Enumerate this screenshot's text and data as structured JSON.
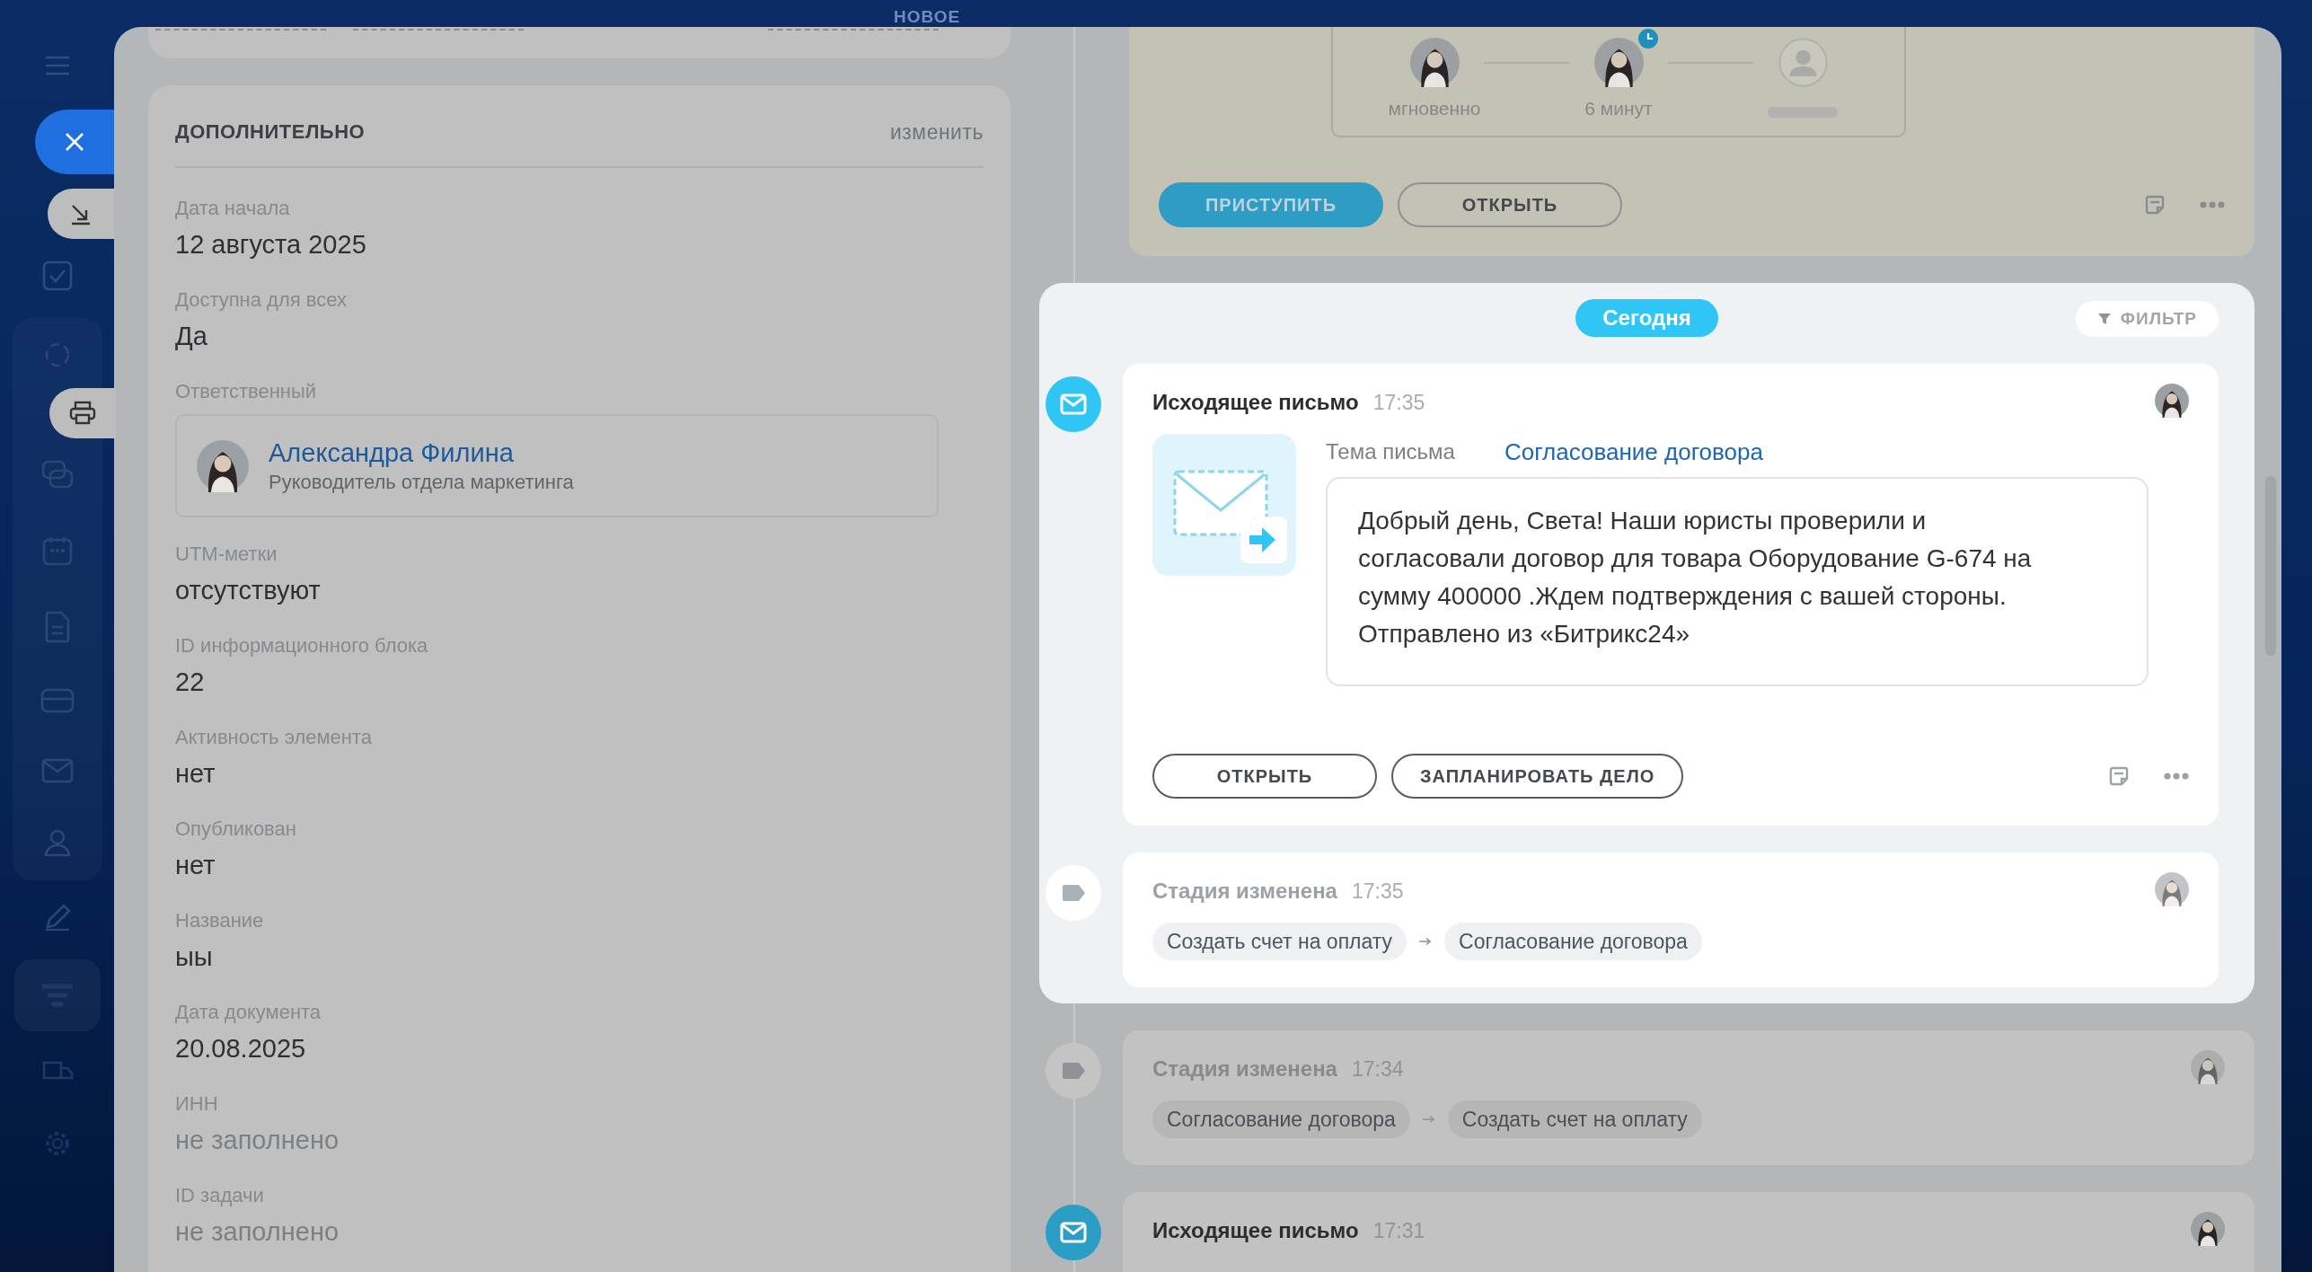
{
  "top_label": "НОВОЕ",
  "details": {
    "title": "ДОПОЛНИТЕЛЬНО",
    "action": "изменить",
    "fields": [
      {
        "kind": "text",
        "label": "Дата начала",
        "value": "12 августа 2025"
      },
      {
        "kind": "text",
        "label": "Доступна для всех",
        "value": "Да"
      },
      {
        "kind": "person",
        "label": "Ответственный",
        "name": "Александра Филина",
        "position": "Руководитель отдела маркетинга"
      },
      {
        "kind": "text",
        "label": "UTM-метки",
        "value": "отсутствуют"
      },
      {
        "kind": "text",
        "label": "ID информационного блока",
        "value": "22"
      },
      {
        "kind": "text",
        "label": "Активность элемента",
        "value": "нет"
      },
      {
        "kind": "text",
        "label": "Опубликован",
        "value": "нет"
      },
      {
        "kind": "text",
        "label": "Название",
        "value": "ыы"
      },
      {
        "kind": "text",
        "label": "Дата документа",
        "value": "20.08.2025"
      },
      {
        "kind": "empty",
        "label": "ИНН",
        "value": "не заполнено"
      },
      {
        "kind": "empty",
        "label": "ID задачи",
        "value": "не заполнено"
      }
    ]
  },
  "timeline": {
    "pending_task": {
      "approvers": [
        {
          "kind": "person",
          "caption": "мгновенно",
          "waiting": false
        },
        {
          "kind": "person",
          "caption": "6 минут",
          "waiting": true
        },
        {
          "kind": "empty",
          "waiting": false
        }
      ],
      "buttons": [
        {
          "label": "ПРИСТУПИТЬ",
          "primary": true
        },
        {
          "label": "ОТКРЫТЬ",
          "primary": false
        }
      ]
    },
    "today": {
      "label": "Сегодня",
      "filter": "ФИЛЬТР",
      "items": [
        {
          "kind": "email",
          "title": "Исходящее письмо",
          "time": "17:35",
          "subject_label": "Тема письма",
          "subject": "Согласование договора",
          "body": "Добрый день, Света! Наши юристы проверили и согласовали договор для товара Оборудование G-674 на сумму 400000 .Ждем подтверждения с вашей стороны. Отправлено из «Битрикс24»",
          "buttons": [
            {
              "label": "ОТКРЫТЬ",
              "primary": false
            },
            {
              "label": "ЗАПЛАНИРОВАТЬ ДЕЛО",
              "primary": false
            }
          ]
        },
        {
          "kind": "stage",
          "title": "Стадия изменена",
          "time": "17:35",
          "from": "Создать счет на оплату",
          "to": "Согласование договора"
        }
      ]
    },
    "earlier_items": [
      {
        "kind": "stage",
        "title": "Стадия изменена",
        "time": "17:34",
        "from": "Согласование договора",
        "to": "Создать счет на оплату"
      },
      {
        "kind": "email",
        "title": "Исходящее письмо",
        "time": "17:31"
      }
    ]
  }
}
